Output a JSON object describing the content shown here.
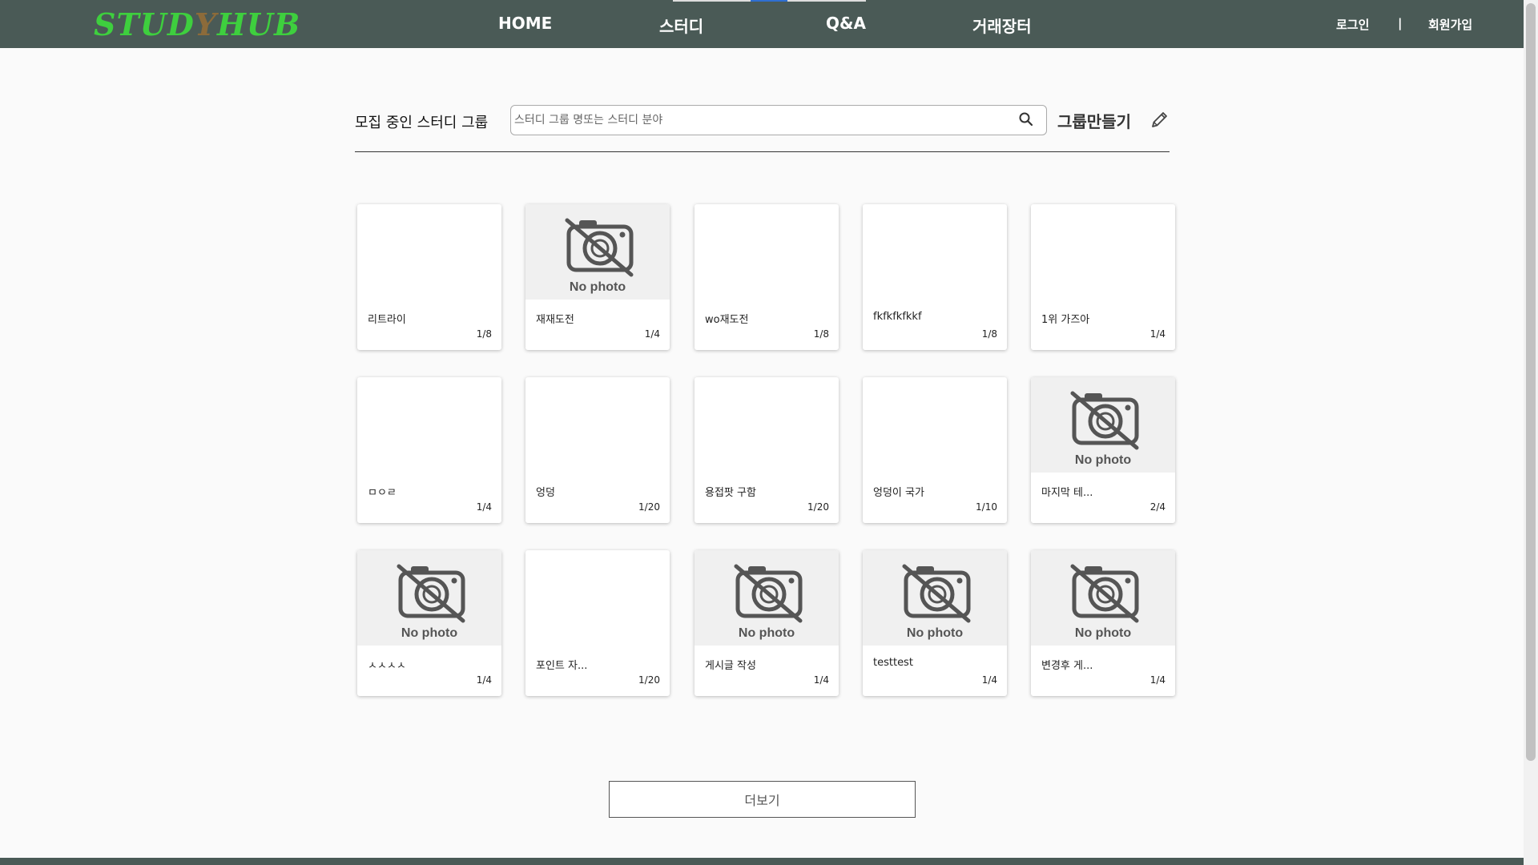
{
  "header": {
    "logo_left": "STUD",
    "logo_y": "Y",
    "logo_right": "HUB",
    "nav": [
      {
        "label": "HOME"
      },
      {
        "label": "스터디"
      },
      {
        "label": "Q&A"
      },
      {
        "label": "거래장터"
      }
    ],
    "login": "로그인",
    "separator": "|",
    "signup": "회원가입"
  },
  "search": {
    "title": "모집 중인 스터디 그룹",
    "placeholder": "스터디 그룹 명또는 스터디 분야",
    "create_label": "그룹만들기"
  },
  "nophoto_text": "No photo",
  "cards": [
    {
      "name": "리트라이",
      "count": "1/8",
      "photo": false
    },
    {
      "name": "재재도전",
      "count": "1/4",
      "photo": true
    },
    {
      "name": "wo재도전",
      "count": "1/8",
      "photo": false
    },
    {
      "name": "fkfkfkfkkf",
      "count": "1/8",
      "photo": false
    },
    {
      "name": "1위 가즈아",
      "count": "1/4",
      "photo": false
    },
    {
      "name": "ㅁㅇㄹ",
      "count": "1/4",
      "photo": false
    },
    {
      "name": "엉덩",
      "count": "1/20",
      "photo": false
    },
    {
      "name": "용접팟 구함",
      "count": "1/20",
      "photo": false
    },
    {
      "name": "엉덩이 국가",
      "count": "1/10",
      "photo": false
    },
    {
      "name": "마지막 테...",
      "count": "2/4",
      "photo": true
    },
    {
      "name": "ㅅㅅㅅㅅ",
      "count": "1/4",
      "photo": true
    },
    {
      "name": "포인트 자...",
      "count": "1/20",
      "photo": false
    },
    {
      "name": "게시글 작성",
      "count": "1/4",
      "photo": true
    },
    {
      "name": "testtest",
      "count": "1/4",
      "photo": true
    },
    {
      "name": "변경후 게...",
      "count": "1/4",
      "photo": true
    }
  ],
  "more_label": "더보기"
}
